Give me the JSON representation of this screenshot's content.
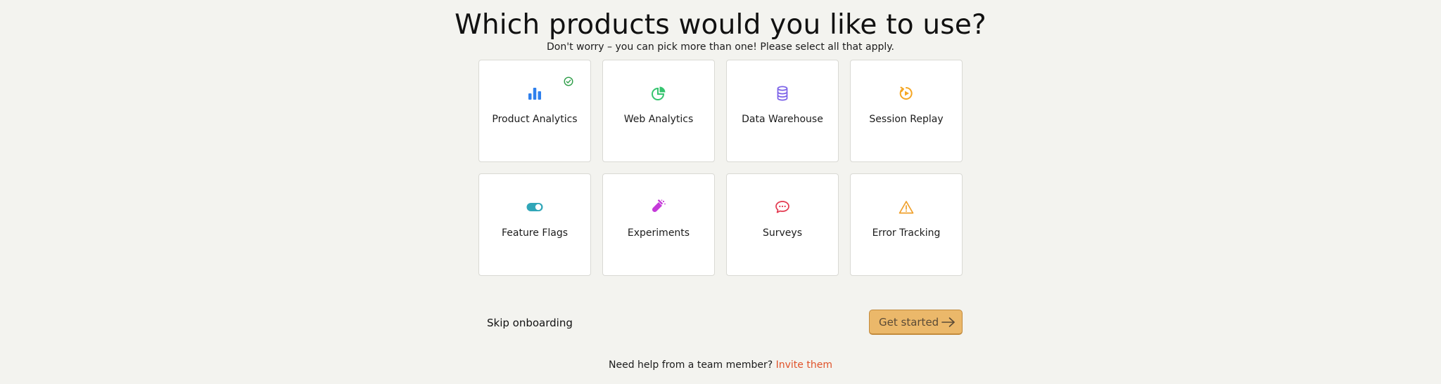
{
  "header": {
    "title": "Which products would you like to use?",
    "subtitle": "Don't worry – you can pick more than one! Please select all that apply."
  },
  "products": [
    {
      "label": "Product Analytics",
      "icon": "bar-chart-icon",
      "color": "#2f80ed",
      "selected": true
    },
    {
      "label": "Web Analytics",
      "icon": "pie-chart-icon",
      "color": "#36c46f",
      "selected": false
    },
    {
      "label": "Data Warehouse",
      "icon": "database-icon",
      "color": "#7b61e8",
      "selected": false
    },
    {
      "label": "Session Replay",
      "icon": "replay-icon",
      "color": "#f5a623",
      "selected": false
    },
    {
      "label": "Feature Flags",
      "icon": "toggle-icon",
      "color": "#30a6b8",
      "selected": false
    },
    {
      "label": "Experiments",
      "icon": "flask-icon",
      "color": "#c53ad9",
      "selected": false
    },
    {
      "label": "Surveys",
      "icon": "chat-bubble-icon",
      "color": "#e3384f",
      "selected": false
    },
    {
      "label": "Error Tracking",
      "icon": "warning-icon",
      "color": "#f0a02b",
      "selected": false
    }
  ],
  "selected_check_color": "#2e9d48",
  "footer": {
    "skip_label": "Skip onboarding",
    "get_started_label": "Get started",
    "help_text": "Need help from a team member?",
    "invite_label": "Invite them"
  },
  "colors": {
    "background": "#f3f3ef",
    "primary_button": "#ebb86a",
    "link": "#e0532a"
  }
}
